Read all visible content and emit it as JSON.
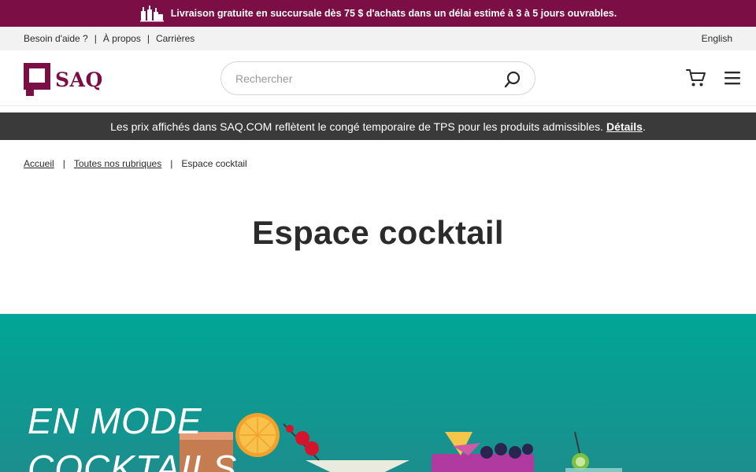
{
  "promo": {
    "text": "Livraison gratuite en succursale dès 75 $ d'achats dans un délai estimé à 3 à 5 jours ouvrables."
  },
  "util": {
    "links": [
      "Besoin d'aide ?",
      "À propos",
      "Carrières"
    ],
    "separator": "|",
    "language": "English"
  },
  "header": {
    "logo_text": "SAQ",
    "search_placeholder": "Rechercher"
  },
  "notice": {
    "text": "Les prix affichés dans SAQ.COM reflètent le congé temporaire de TPS pour les produits admissibles.",
    "link": "Détails",
    "suffix": "."
  },
  "breadcrumb": {
    "items": [
      "Accueil",
      "Toutes nos rubriques",
      "Espace cocktail"
    ],
    "separator": "|"
  },
  "page": {
    "title": "Espace cocktail"
  },
  "hero": {
    "title": "EN MODE COCKTAILS"
  },
  "colors": {
    "brand": "#7a0e45",
    "notice_bg": "#3a3a3a",
    "hero_bg": "#00a697"
  }
}
